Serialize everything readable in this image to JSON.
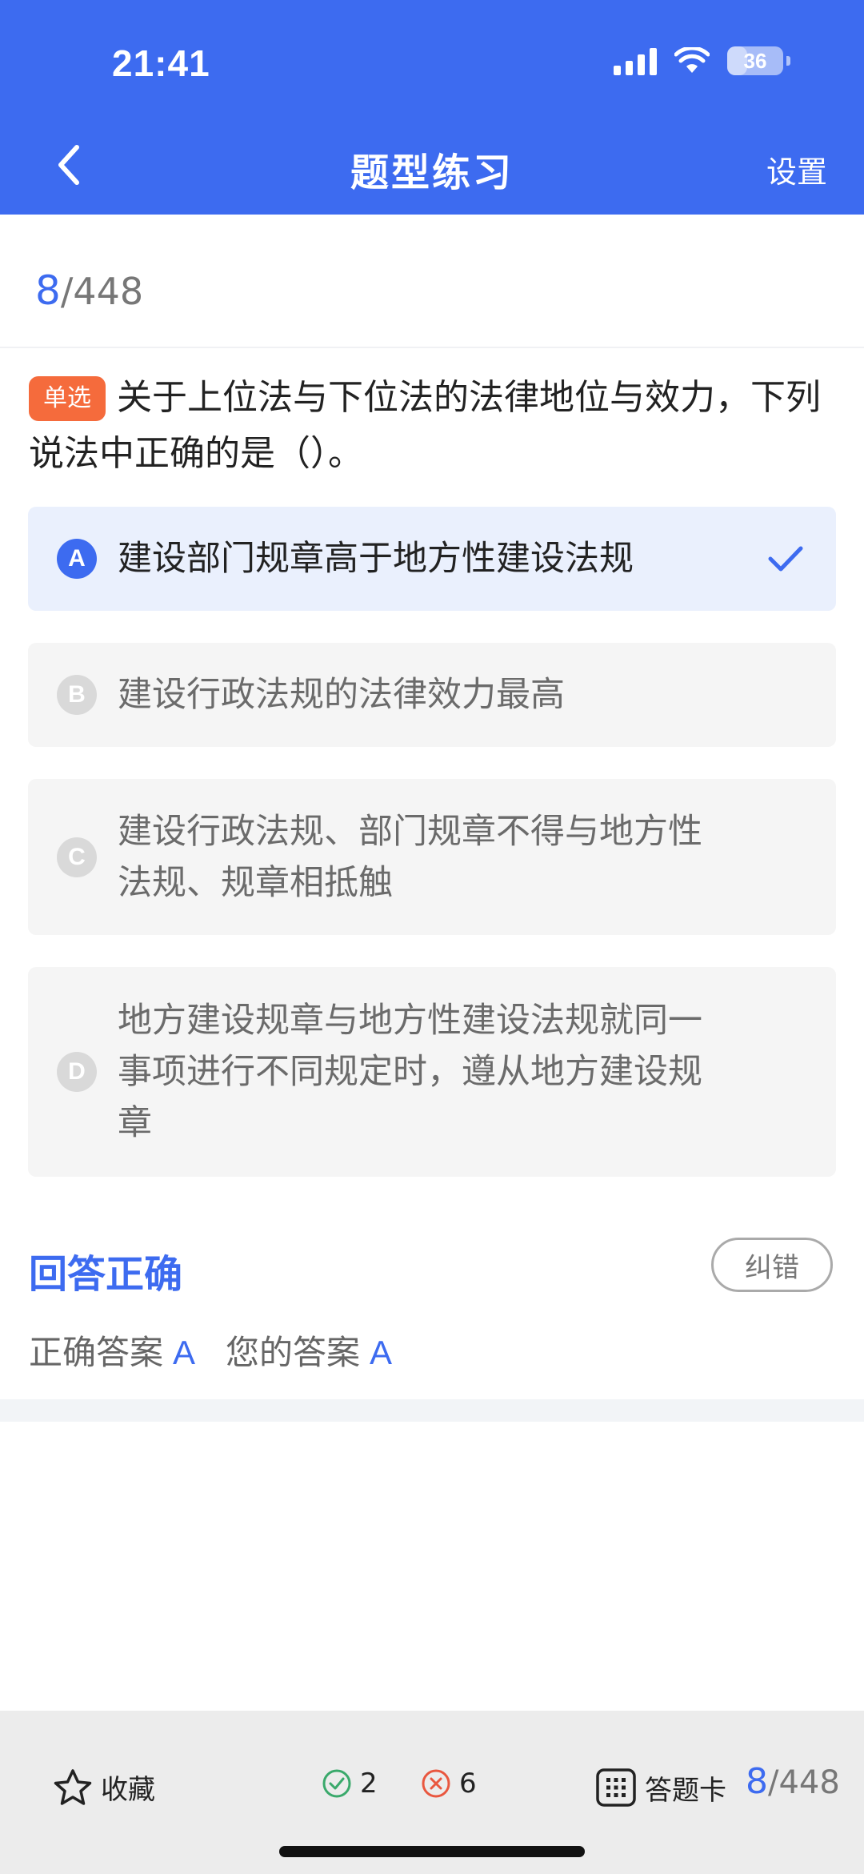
{
  "status_bar": {
    "time": "21:41",
    "battery": "36"
  },
  "header": {
    "title": "题型练习",
    "settings_label": "设置"
  },
  "progress": {
    "current": "8",
    "total": "/448"
  },
  "question": {
    "type_badge": "单选",
    "text": "关于上位法与下位法的法律地位与效力，下列说法中正确的是（）。"
  },
  "options": [
    {
      "letter": "A",
      "text": "建设部门规章高于地方性建设法规",
      "selected": true
    },
    {
      "letter": "B",
      "text": "建设行政法规的法律效力最高",
      "selected": false
    },
    {
      "letter": "C",
      "text": "建设行政法规、部门规章不得与地方性法规、规章相抵触",
      "selected": false
    },
    {
      "letter": "D",
      "text": "地方建设规章与地方性建设法规就同一事项进行不同规定时，遵从地方建设规章",
      "selected": false
    }
  ],
  "result": {
    "title": "回答正确",
    "report_label": "纠错",
    "correct_answer_label": "正确答案",
    "correct_answer": "A",
    "your_answer_label": "您的答案",
    "your_answer": "A"
  },
  "bottom_bar": {
    "favorite_label": "收藏",
    "correct_count": "2",
    "wrong_count": "6",
    "answer_card_label": "答题卡",
    "progress_current": "8",
    "progress_total": "/448"
  },
  "colors": {
    "accent": "#3d6bf0",
    "badge": "#f56b3c",
    "correct": "#3aa96b",
    "wrong": "#e9573f"
  }
}
